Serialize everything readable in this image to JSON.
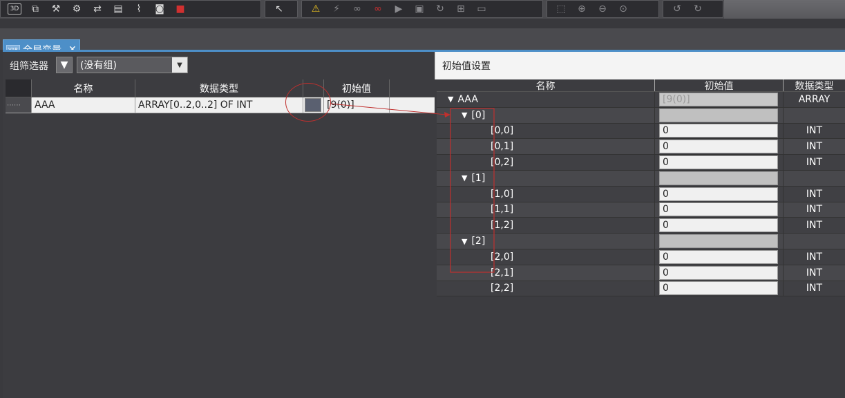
{
  "toolbar": {
    "groups": [
      {
        "buttons": [
          "3d-view-icon",
          "window-icon",
          "hammer-icon",
          "build-icon",
          "transfer-icon",
          "memory-icon",
          "io-icon",
          "binoculars-icon",
          "stop-icon"
        ]
      },
      {
        "buttons": [
          "cursor-icon"
        ]
      },
      {
        "buttons": [
          "warning-icon",
          "simulate-icon",
          "glasses-icon",
          "glasses-red-icon",
          "play-icon",
          "step-icon",
          "refresh-icon",
          "network-icon",
          "monitor-icon"
        ]
      },
      {
        "buttons": [
          "frame-icon",
          "zoom-in-icon",
          "zoom-out-icon",
          "zoom-100-icon"
        ]
      },
      {
        "buttons": [
          "undo-icon",
          "redo-icon"
        ]
      }
    ],
    "box3d_label": "3D"
  },
  "tab": {
    "label": "全局变量",
    "close": "✕",
    "icon_label": "VAR"
  },
  "filter": {
    "label": "组筛选器",
    "selected": "(没有组)"
  },
  "var_table": {
    "headers": {
      "name": "名称",
      "type": "数据类型",
      "init": "初始值"
    },
    "rows": [
      {
        "name": "AAA",
        "type": "ARRAY[0..2,0..2] OF INT",
        "init": "[9(0)]"
      }
    ]
  },
  "dialog": {
    "title": "初始值设置",
    "headers": {
      "name": "名称",
      "init": "初始值",
      "type": "数据类型"
    },
    "rows": [
      {
        "name": "AAA",
        "level": 0,
        "expander": "▼",
        "init": "[9(0)]",
        "init_style": "disabled",
        "type": "ARRAY"
      },
      {
        "name": "[0]",
        "level": 1,
        "expander": "▼",
        "init": "",
        "init_style": "empty",
        "type": ""
      },
      {
        "name": "[0,0]",
        "level": 2,
        "expander": "",
        "init": "0",
        "init_style": "normal",
        "type": "INT"
      },
      {
        "name": "[0,1]",
        "level": 2,
        "expander": "",
        "init": "0",
        "init_style": "normal",
        "type": "INT"
      },
      {
        "name": "[0,2]",
        "level": 2,
        "expander": "",
        "init": "0",
        "init_style": "normal",
        "type": "INT"
      },
      {
        "name": "[1]",
        "level": 1,
        "expander": "▼",
        "init": "",
        "init_style": "empty",
        "type": ""
      },
      {
        "name": "[1,0]",
        "level": 2,
        "expander": "",
        "init": "0",
        "init_style": "normal",
        "type": "INT"
      },
      {
        "name": "[1,1]",
        "level": 2,
        "expander": "",
        "init": "0",
        "init_style": "normal",
        "type": "INT"
      },
      {
        "name": "[1,2]",
        "level": 2,
        "expander": "",
        "init": "0",
        "init_style": "normal",
        "type": "INT"
      },
      {
        "name": "[2]",
        "level": 1,
        "expander": "▼",
        "init": "",
        "init_style": "empty",
        "type": ""
      },
      {
        "name": "[2,0]",
        "level": 2,
        "expander": "",
        "init": "0",
        "init_style": "normal",
        "type": "INT"
      },
      {
        "name": "[2,1]",
        "level": 2,
        "expander": "",
        "init": "0",
        "init_style": "normal",
        "type": "INT"
      },
      {
        "name": "[2,2]",
        "level": 2,
        "expander": "",
        "init": "0",
        "init_style": "normal",
        "type": "INT"
      }
    ]
  },
  "colors": {
    "accent": "#4d8fc8",
    "annotation": "#c0302e",
    "dark_bg": "#3c3c40"
  }
}
